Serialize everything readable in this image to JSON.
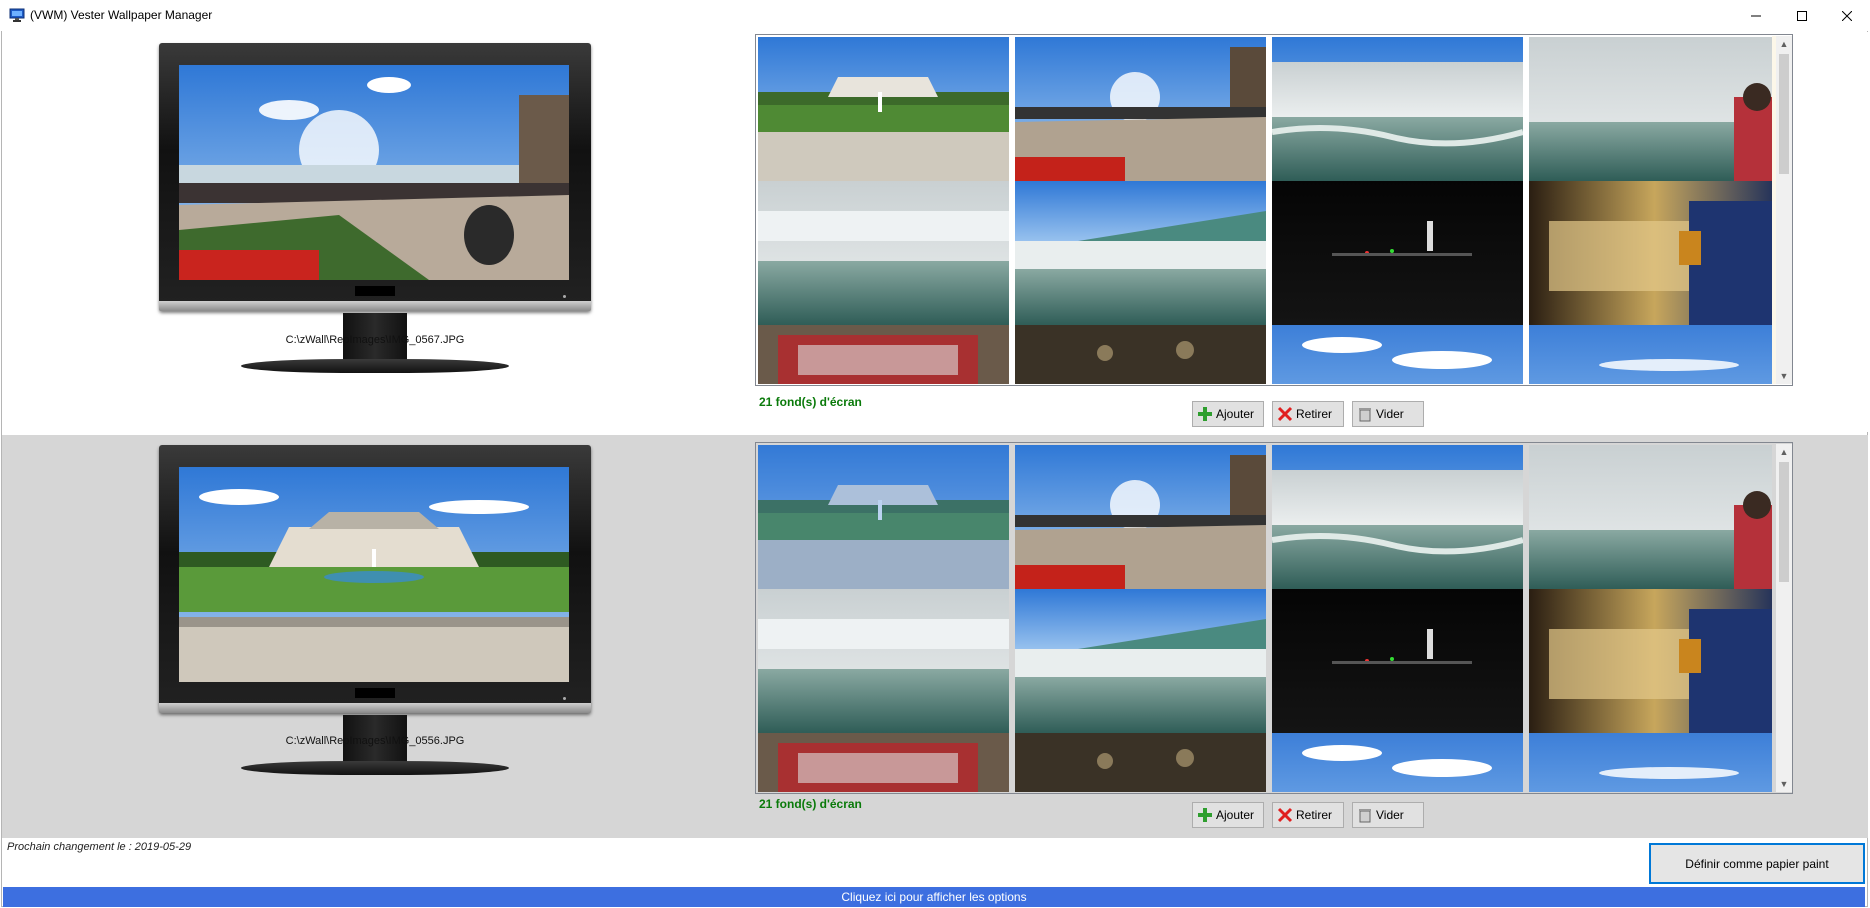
{
  "window": {
    "title": "(VWM) Vester Wallpaper Manager",
    "icon": "monitor-icon",
    "controls": [
      "minimize-icon",
      "maximize-icon",
      "close-icon"
    ]
  },
  "screens": [
    {
      "current_path": "C:\\zWall\\RepImages\\IMG_0567.JPG",
      "wallpaper_count": "21 fond(s) d'écran",
      "buttons": {
        "add": "Ajouter",
        "remove": "Retirer",
        "clear": "Vider"
      }
    },
    {
      "current_path": "C:\\zWall\\RepImages\\IMG_0556.JPG",
      "wallpaper_count": "21 fond(s) d'écran",
      "buttons": {
        "add": "Ajouter",
        "remove": "Retirer",
        "clear": "Vider"
      }
    }
  ],
  "next_change": "Prochain changement le : 2019-05-29",
  "set_wallpaper_label": "Définir comme papier paint",
  "options_bar_label": "Cliquez ici pour afficher les options",
  "colors": {
    "count_text": "#0a7a0a",
    "options_bar": "#3d6fe0",
    "selected_panel": "#d6d6d6",
    "focus_border": "#0078d7"
  }
}
